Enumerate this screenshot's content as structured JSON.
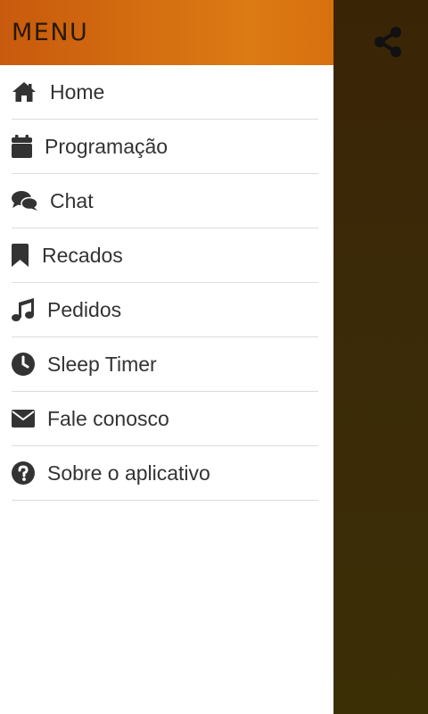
{
  "drawer": {
    "title": "MENU",
    "items": [
      {
        "label": "Home",
        "icon": "home-icon"
      },
      {
        "label": "Programação",
        "icon": "calendar-icon"
      },
      {
        "label": "Chat",
        "icon": "chat-icon"
      },
      {
        "label": "Recados",
        "icon": "bookmark-icon"
      },
      {
        "label": "Pedidos",
        "icon": "music-icon"
      },
      {
        "label": "Sleep Timer",
        "icon": "clock-icon"
      },
      {
        "label": "Fale conosco",
        "icon": "envelope-icon"
      },
      {
        "label": "Sobre o aplicativo",
        "icon": "question-circle-icon"
      }
    ]
  },
  "toolbar": {
    "share_icon": "share-icon"
  },
  "colors": {
    "header_orange": "#d46e10",
    "backdrop_brown": "#3b2a08",
    "text": "#333333",
    "divider": "#dcdcdc"
  }
}
